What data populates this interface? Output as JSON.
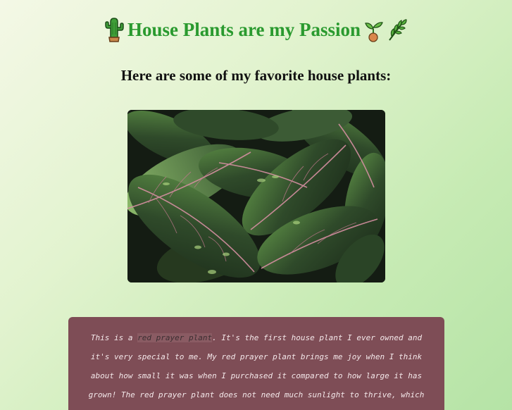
{
  "page": {
    "title": "House Plants are my Passion",
    "subtitle": "Here are some of my favorite house plants:",
    "title_icons": [
      "cactus-icon",
      "seedling-icon",
      "herb-icon"
    ]
  },
  "photo": {
    "subject": "red prayer plant leaves"
  },
  "description": {
    "text_before": "This is a ",
    "link_text": "red prayer plant",
    "text_after": ". It's the first house plant I ever owned and it's very special to me. My red prayer plant brings me joy when I think about how small it was when I purchased it compared to how large it has grown! The red prayer plant does not need much sunlight to thrive, which"
  },
  "colors": {
    "title": "#2a9a2f",
    "description_background": "#7e4d56",
    "description_text": "#f4e8ea"
  }
}
